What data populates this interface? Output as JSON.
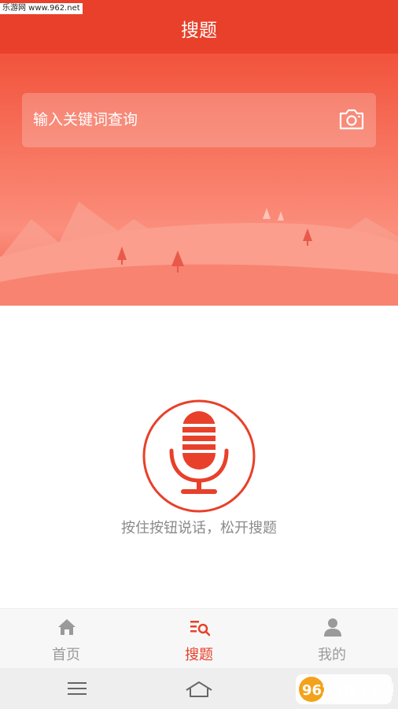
{
  "watermark": "乐游网 www.962.net",
  "header": {
    "title": "搜题"
  },
  "search": {
    "placeholder": "输入关键词查询",
    "camera_icon": "camera-icon"
  },
  "voice": {
    "hint": "按住按钮说话，松开搜题",
    "mic_icon": "microphone-icon"
  },
  "tabs": [
    {
      "label": "首页",
      "icon": "home-icon",
      "active": false
    },
    {
      "label": "搜题",
      "icon": "search-list-icon",
      "active": true
    },
    {
      "label": "我的",
      "icon": "user-icon",
      "active": false
    }
  ],
  "colors": {
    "accent": "#e8402a",
    "inactive": "#9a9a9a"
  },
  "logo": {
    "text": "962.NET 乐游网"
  }
}
